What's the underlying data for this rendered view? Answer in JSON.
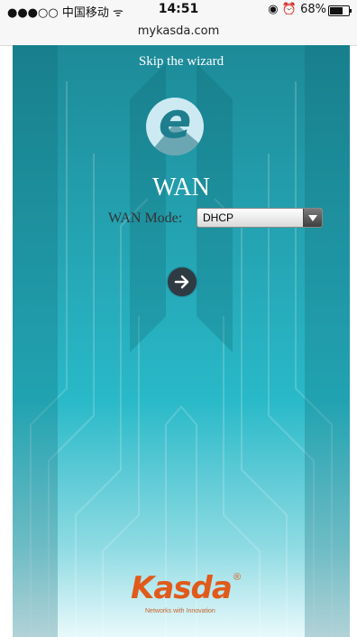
{
  "status_bar": {
    "carrier": "●●●○○ 中国移动 ",
    "wifi_icon": "wifi-icon",
    "time": "14:51",
    "battery_percent": "68%",
    "battery_level": 0.68
  },
  "browser": {
    "url": "mykasda.com"
  },
  "wizard": {
    "skip_label": "Skip the wizard",
    "page_icon": "internet-explorer-icon",
    "title": "WAN",
    "mode_label": "WAN Mode:",
    "mode_value": "DHCP",
    "next_icon": "arrow-right-icon"
  },
  "brand": {
    "logo_text": "Kasda",
    "registered": "®",
    "tagline": "Networks with Innovation",
    "accent_color": "#e05a1c"
  }
}
